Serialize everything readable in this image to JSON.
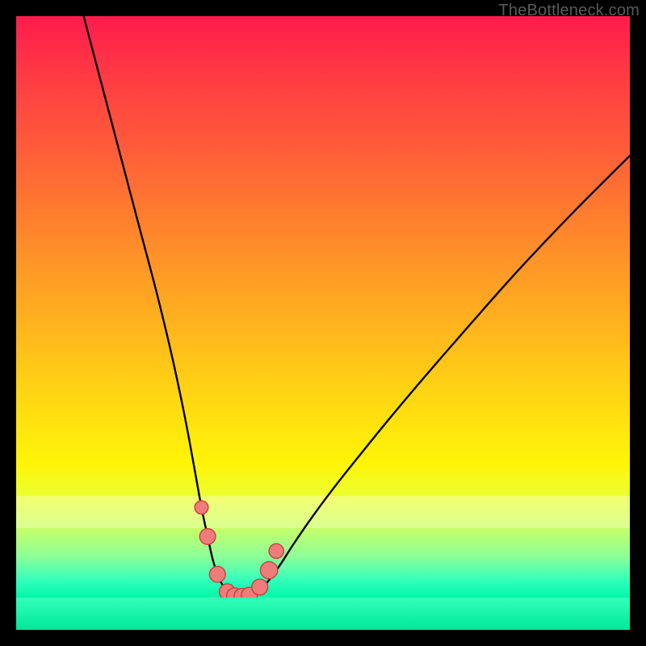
{
  "watermark": "TheBottleneck.com",
  "chart_data": {
    "type": "line",
    "title": "",
    "xlabel": "",
    "ylabel": "",
    "xlim": [
      0,
      100
    ],
    "ylim": [
      0,
      100
    ],
    "grid": false,
    "background": "vertical rainbow gradient red→orange→yellow→green",
    "series": [
      {
        "name": "left-curve",
        "x": [
          11,
          14,
          17,
          20,
          23,
          25.5,
          27.5,
          29,
          30.2,
          31.2,
          32,
          32.8,
          33.6,
          34.4,
          35.2
        ],
        "y": [
          100,
          88,
          76,
          64,
          52,
          41,
          31,
          22.5,
          15.5,
          10.5,
          6.7,
          4.0,
          2.2,
          1.0,
          0.3
        ]
      },
      {
        "name": "right-curve",
        "x": [
          38.5,
          39.7,
          41.2,
          43.0,
          45.2,
          48.0,
          51.5,
          56.0,
          61.0,
          67.0,
          74.0,
          82.0,
          91.0,
          100.0
        ],
        "y": [
          0.3,
          1.2,
          3.0,
          5.6,
          9.2,
          13.5,
          18.5,
          24.5,
          31.0,
          38.5,
          47.0,
          56.5,
          66.5,
          76.0
        ]
      },
      {
        "name": "valley-floor",
        "x": [
          35.2,
          36.0,
          37.0,
          37.8,
          38.5
        ],
        "y": [
          0.15,
          0.0,
          0.0,
          0.0,
          0.15
        ]
      }
    ],
    "markers": [
      {
        "name": "left-top",
        "x": 30.2,
        "y": 15.5,
        "r": 1.1
      },
      {
        "name": "left-2",
        "x": 31.2,
        "y": 10.5,
        "r": 1.3
      },
      {
        "name": "left-3",
        "x": 32.8,
        "y": 4.0,
        "r": 1.3
      },
      {
        "name": "floor-1",
        "x": 34.4,
        "y": 1.0,
        "r": 1.3
      },
      {
        "name": "floor-2",
        "x": 35.6,
        "y": 0.3,
        "r": 1.3
      },
      {
        "name": "floor-3",
        "x": 36.8,
        "y": 0.2,
        "r": 1.3
      },
      {
        "name": "floor-4",
        "x": 38.0,
        "y": 0.4,
        "r": 1.3
      },
      {
        "name": "right-3",
        "x": 39.7,
        "y": 1.8,
        "r": 1.3
      },
      {
        "name": "right-2",
        "x": 41.2,
        "y": 4.7,
        "r": 1.4
      },
      {
        "name": "right-top",
        "x": 42.4,
        "y": 8.0,
        "r": 1.2
      }
    ],
    "marker_style": {
      "fill": "#f07b7b",
      "stroke": "#c93f3c"
    }
  }
}
